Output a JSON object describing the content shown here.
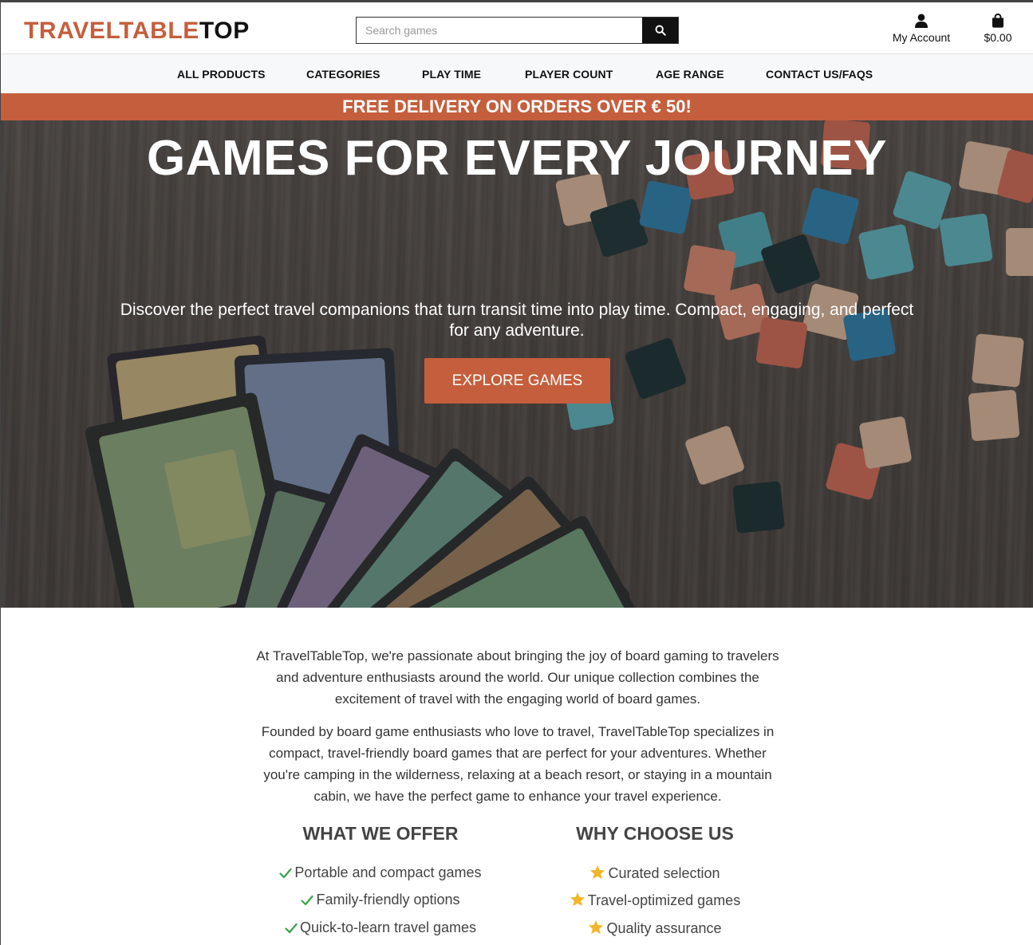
{
  "header": {
    "logo_part1": "TRAVELTABLE",
    "logo_part2": "TOP",
    "search_placeholder": "Search games",
    "account_label": "My Account",
    "cart_total": "$0.00"
  },
  "nav": {
    "items": [
      "ALL PRODUCTS",
      "CATEGORIES",
      "PLAY TIME",
      "PLAYER COUNT",
      "AGE RANGE",
      "CONTACT US/FAQS"
    ]
  },
  "banner": {
    "text": "FREE DELIVERY ON ORDERS OVER € 50!"
  },
  "hero": {
    "title": "GAMES FOR EVERY JOURNEY",
    "subtitle": "Discover the perfect travel companions that turn transit time into play time. Compact, engaging, and perfect for any adventure.",
    "button_label": "EXPLORE GAMES"
  },
  "about": {
    "paragraph1": "At TravelTableTop, we're passionate about bringing the joy of board gaming to travelers and adventure enthusiasts around the world. Our unique collection combines the excitement of travel with the engaging world of board games.",
    "paragraph2": "Founded by board game enthusiasts who love to travel, TravelTableTop specializes in compact, travel-friendly board games that are perfect for your adventures. Whether you're camping in the wilderness, relaxing at a beach resort, or staying in a mountain cabin, we have the perfect game to enhance your travel experience.",
    "offer": {
      "title": "WHAT WE OFFER",
      "items": [
        "Portable and compact games",
        "Family-friendly options",
        "Quick-to-learn travel games"
      ]
    },
    "why": {
      "title": "WHY CHOOSE US",
      "items": [
        "Curated selection",
        "Travel-optimized games",
        "Quality assurance"
      ]
    }
  },
  "colors": {
    "accent": "#c55e3c",
    "check": "#3aa04a",
    "star": "#f2b52a",
    "nav_bg": "#f7f8f9"
  },
  "icons": {
    "search": "search-icon",
    "account": "user-icon",
    "cart": "shopping-bag-icon",
    "check": "check-icon",
    "star": "star-icon"
  }
}
